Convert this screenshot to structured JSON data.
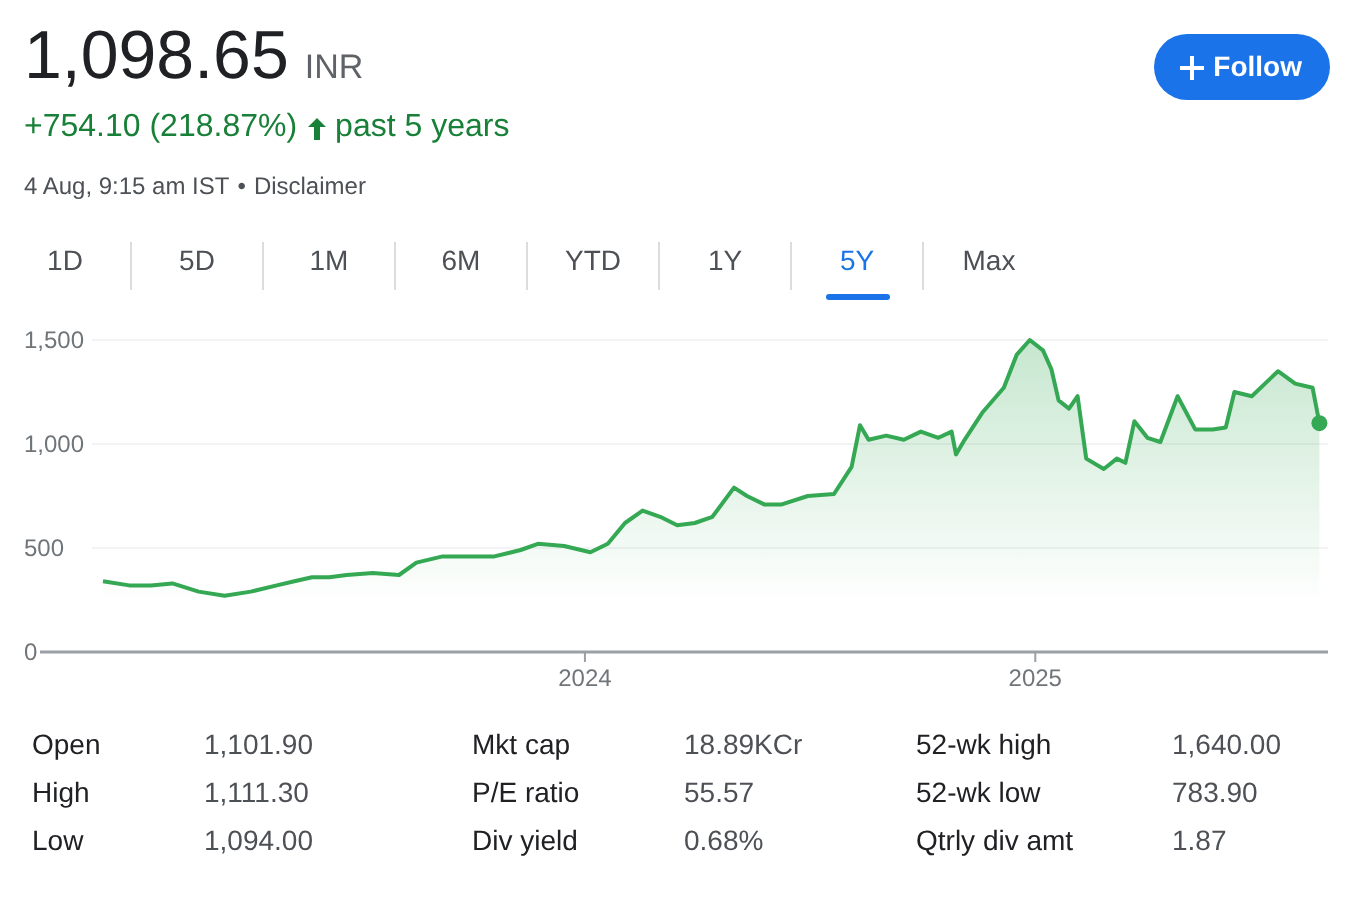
{
  "quote": {
    "price": "1,098.65",
    "currency": "INR",
    "change": "+754.10 (218.87%)",
    "period": "past 5 years",
    "positive": true,
    "timestamp": "4 Aug, 9:15 am IST",
    "separator": "•",
    "disclaimer": "Disclaimer"
  },
  "follow_button": {
    "label": "Follow"
  },
  "tabs": [
    {
      "label": "1D",
      "selected": false
    },
    {
      "label": "5D",
      "selected": false
    },
    {
      "label": "1M",
      "selected": false
    },
    {
      "label": "6M",
      "selected": false
    },
    {
      "label": "YTD",
      "selected": false
    },
    {
      "label": "1Y",
      "selected": false
    },
    {
      "label": "5Y",
      "selected": true
    },
    {
      "label": "Max",
      "selected": false
    }
  ],
  "chart": {
    "chart_data": {
      "type": "area",
      "grid": true,
      "x": [
        2022.93,
        2022.988,
        2023.036,
        2023.084,
        2023.142,
        2023.2,
        2023.258,
        2023.316,
        2023.355,
        2023.394,
        2023.432,
        2023.471,
        2023.529,
        2023.587,
        2023.626,
        2023.684,
        2023.741,
        2023.799,
        2023.857,
        2023.896,
        2023.954,
        2024.012,
        2024.051,
        2024.089,
        2024.128,
        2024.167,
        2024.205,
        2024.244,
        2024.283,
        2024.331,
        2024.36,
        2024.398,
        2024.437,
        2024.495,
        2024.553,
        2024.592,
        2024.611,
        2024.63,
        2024.669,
        2024.708,
        2024.746,
        2024.785,
        2024.814,
        2024.824,
        2024.843,
        2024.882,
        2024.93,
        2024.959,
        2024.988,
        2025.017,
        2025.036,
        2025.052,
        2025.075,
        2025.094,
        2025.113,
        2025.152,
        2025.181,
        2025.2,
        2025.22,
        2025.249,
        2025.278,
        2025.316,
        2025.355,
        2025.394,
        2025.423,
        2025.442,
        2025.481,
        2025.51,
        2025.539,
        2025.577,
        2025.616,
        2025.631
      ],
      "series": [
        {
          "color": "#34a853",
          "values": [
            340,
            320,
            320,
            330,
            290,
            270,
            290,
            320,
            340,
            360,
            360,
            370,
            380,
            370,
            430,
            460,
            460,
            460,
            490,
            520,
            510,
            480,
            520,
            620,
            680,
            650,
            610,
            620,
            650,
            790,
            750,
            710,
            710,
            750,
            760,
            890,
            1090,
            1020,
            1040,
            1020,
            1060,
            1030,
            1060,
            950,
            1020,
            1150,
            1270,
            1430,
            1500,
            1450,
            1360,
            1210,
            1170,
            1230,
            930,
            880,
            930,
            910,
            1110,
            1030,
            1010,
            1230,
            1070,
            1070,
            1080,
            1250,
            1230,
            1290,
            1350,
            1290,
            1270,
            1100
          ]
        }
      ],
      "xlim": [
        2022.79,
        2025.65
      ],
      "ylim": [
        0,
        1500
      ],
      "xticks": [
        {
          "value": 2024,
          "label": "2024"
        },
        {
          "value": 2025,
          "label": "2025"
        }
      ],
      "yticks": [
        {
          "value": 0,
          "label": "0"
        },
        {
          "value": 500,
          "label": "500"
        },
        {
          "value": 1000,
          "label": "1,000"
        },
        {
          "value": 1500,
          "label": "1,500"
        }
      ]
    }
  },
  "stats": [
    [
      {
        "label": "Open",
        "value": "1,101.90"
      },
      {
        "label": "High",
        "value": "1,111.30"
      },
      {
        "label": "Low",
        "value": "1,094.00"
      }
    ],
    [
      {
        "label": "Mkt cap",
        "value": "18.89KCr"
      },
      {
        "label": "P/E ratio",
        "value": "55.57"
      },
      {
        "label": "Div yield",
        "value": "0.68%"
      }
    ],
    [
      {
        "label": "52-wk high",
        "value": "1,640.00"
      },
      {
        "label": "52-wk low",
        "value": "783.90"
      },
      {
        "label": "Qtrly div amt",
        "value": "1.87"
      }
    ]
  ]
}
